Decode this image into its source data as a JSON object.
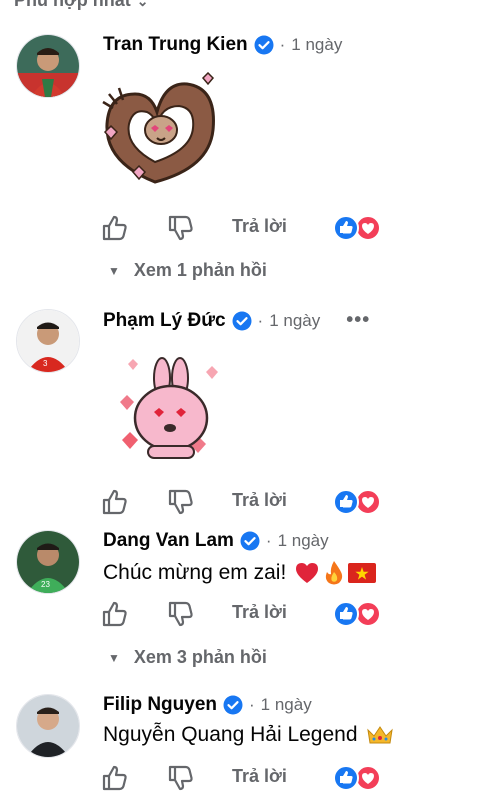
{
  "sort": {
    "label": "Phù hợp nhất"
  },
  "comments": [
    {
      "name": "Tran Trung Kien",
      "time": "1 ngày",
      "reply_label": "Trả lời",
      "replies_label": "Xem 1 phản hồi"
    },
    {
      "name": "Phạm Lý Đức",
      "time": "1 ngày",
      "reply_label": "Trả lời",
      "more": "•••"
    },
    {
      "name": "Dang Van Lam",
      "time": "1 ngày",
      "text": "Chúc mừng em zai!",
      "reply_label": "Trả lời",
      "replies_label": "Xem 3 phản hồi"
    },
    {
      "name": "Filip Nguyen",
      "time": "1 ngày",
      "text": "Nguyễn Quang Hải Legend",
      "reply_label": "Trả lời"
    }
  ],
  "meta_sep": "·",
  "colors": {
    "verified": "#1877f2",
    "like": "#1877f2",
    "love": "#f33e58",
    "secondary": "#65676b"
  }
}
